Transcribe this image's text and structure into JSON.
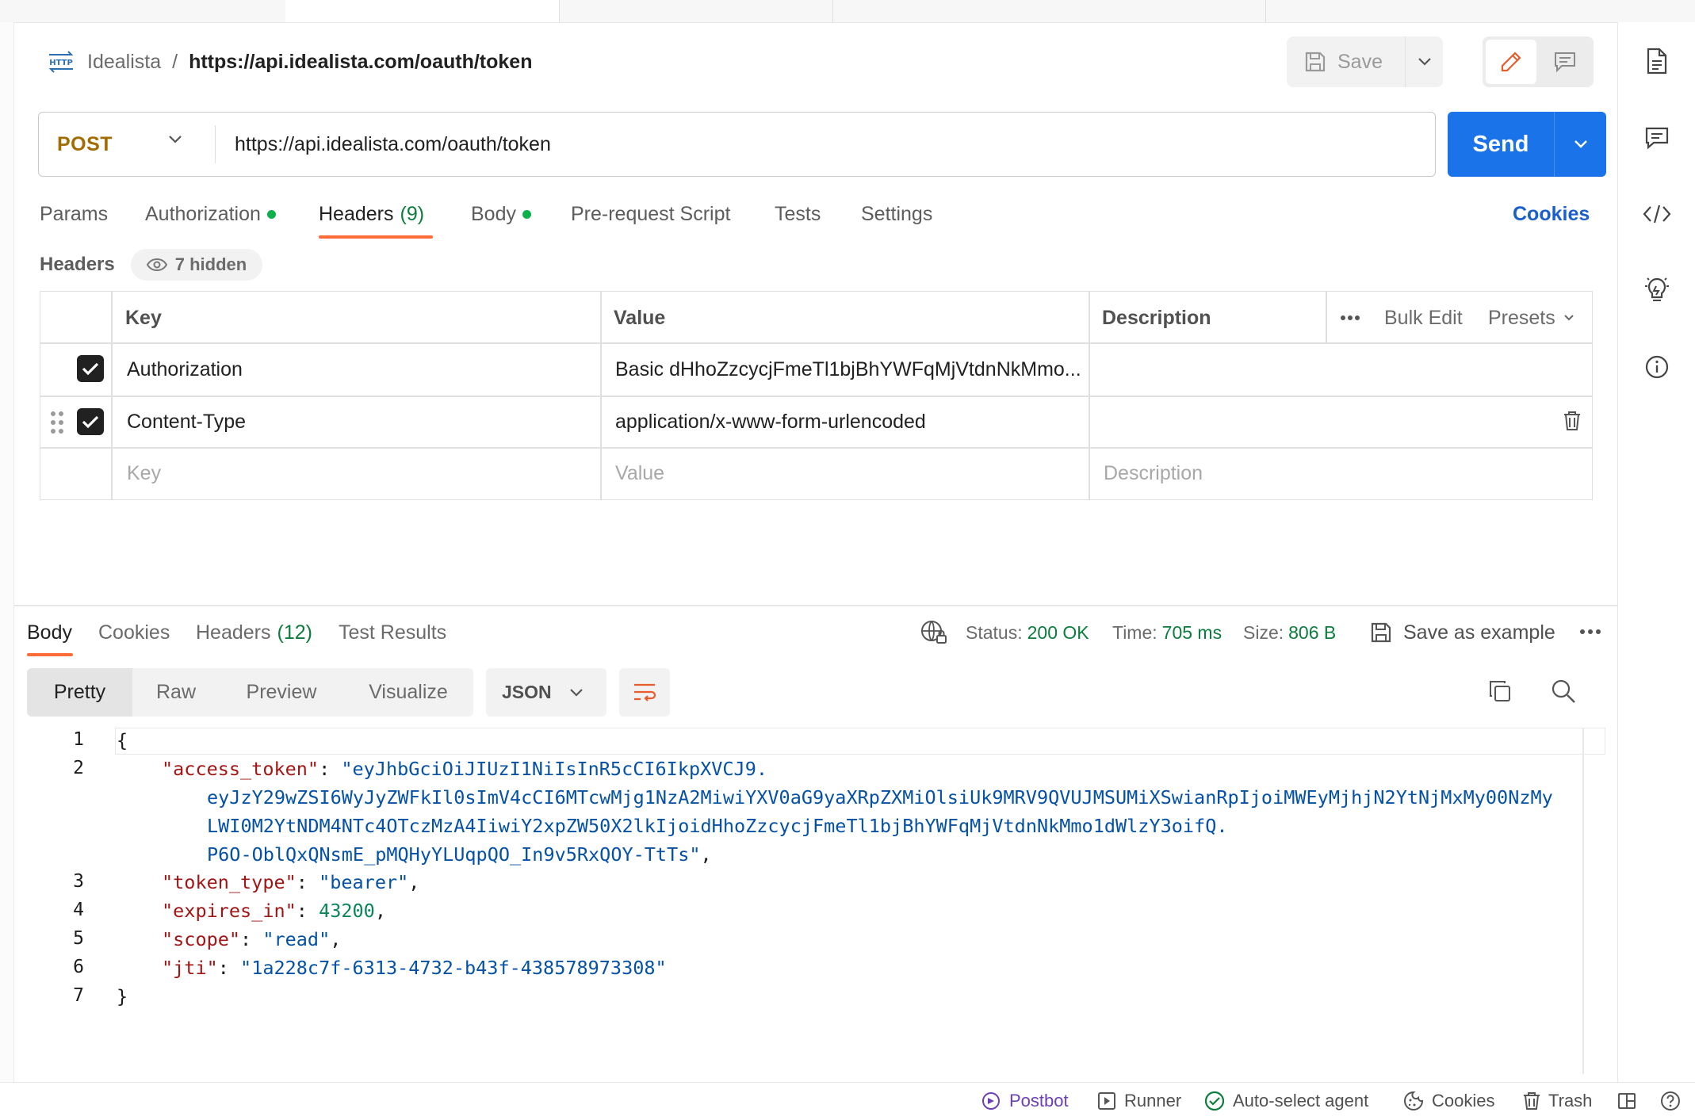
{
  "breadcrumb": {
    "collection": "Idealista",
    "separator": "/",
    "request_name": "https://api.idealista.com/oauth/token",
    "http_badge": "HTTP"
  },
  "toolbar": {
    "save_label": "Save"
  },
  "request": {
    "method": "POST",
    "url": "https://api.idealista.com/oauth/token",
    "send_label": "Send"
  },
  "req_tabs": {
    "params": "Params",
    "authorization": "Authorization",
    "headers": "Headers",
    "headers_count": "(9)",
    "body": "Body",
    "prerequest": "Pre-request Script",
    "tests": "Tests",
    "settings": "Settings",
    "cookies": "Cookies"
  },
  "headers_section": {
    "label": "Headers",
    "hidden": "7 hidden"
  },
  "headers_table": {
    "columns": {
      "key": "Key",
      "value": "Value",
      "description": "Description"
    },
    "bulk_edit": "Bulk Edit",
    "presets": "Presets",
    "rows": [
      {
        "checked": true,
        "key": "Authorization",
        "value": "Basic dHhoZzcycjFmeTl1bjBhYWFqMjVtdnNkMmo...",
        "description": ""
      },
      {
        "checked": true,
        "key": "Content-Type",
        "value": "application/x-www-form-urlencoded",
        "description": ""
      }
    ],
    "placeholders": {
      "key": "Key",
      "value": "Value",
      "description": "Description"
    }
  },
  "response": {
    "tabs": {
      "body": "Body",
      "cookies": "Cookies",
      "headers": "Headers",
      "headers_count": "(12)",
      "test_results": "Test Results"
    },
    "status_label": "Status:",
    "status_value": "200 OK",
    "time_label": "Time:",
    "time_value": "705 ms",
    "size_label": "Size:",
    "size_value": "806 B",
    "save_example": "Save as example",
    "views": {
      "pretty": "Pretty",
      "raw": "Raw",
      "preview": "Preview",
      "visualize": "Visualize"
    },
    "format": "JSON"
  },
  "code": {
    "line_numbers": [
      "1",
      "2",
      "3",
      "4",
      "5",
      "6",
      "7"
    ],
    "open_brace": "{",
    "close_brace": "}",
    "access_token_key": "\"access_token\"",
    "access_token_l1": "\"eyJhbGciOiJIUzI1NiIsInR5cCI6IkpXVCJ9.",
    "access_token_l2": "eyJzY29wZSI6WyJyZWFkIl0sImV4cCI6MTcwMjg1NzA2MiwiYXV0aG9yaXRpZXMiOlsiUk9MRV9QVUJMSUMiXSwianRpIjoiMWEyMjhjN2YtNjMxMy00NzMy",
    "access_token_l3": "LWI0M2YtNDM4NTc4OTczMzA4IiwiY2xpZW50X2lkIjoidHhoZzcycjFmeTl1bjBhYWFqMjVtdnNkMmo1dWlzY3oifQ.",
    "access_token_l4": "P6O-OblQxQNsmE_pMQHyYLUqpQO_In9v5RxQOY-TtTs\"",
    "token_type_key": "\"token_type\"",
    "token_type_val": "\"bearer\"",
    "expires_in_key": "\"expires_in\"",
    "expires_in_val": "43200",
    "scope_key": "\"scope\"",
    "scope_val": "\"read\"",
    "jti_key": "\"jti\"",
    "jti_val": "\"1a228c7f-6313-4732-b43f-438578973308\""
  },
  "footer": {
    "postbot": "Postbot",
    "runner": "Runner",
    "agent": "Auto-select agent",
    "cookies": "Cookies",
    "trash": "Trash"
  },
  "colors": {
    "accent": "#ff6c37",
    "send": "#1a73e8",
    "method": "#a26c00",
    "status_ok": "#0c7d3c",
    "link": "#1a5fcb"
  },
  "icons": [
    "http-icon",
    "save-icon",
    "chevron-down-icon",
    "pencil-icon",
    "comment-icon",
    "document-icon",
    "code-icon",
    "lightbulb-icon",
    "info-icon",
    "eye-icon",
    "more-icon",
    "drag-handle-icon",
    "trash-icon",
    "globe-lock-icon",
    "wrap-icon",
    "copy-icon",
    "search-icon",
    "postbot-icon",
    "runner-icon",
    "check-circle-icon",
    "cookie-icon",
    "layout-icon",
    "help-icon"
  ]
}
